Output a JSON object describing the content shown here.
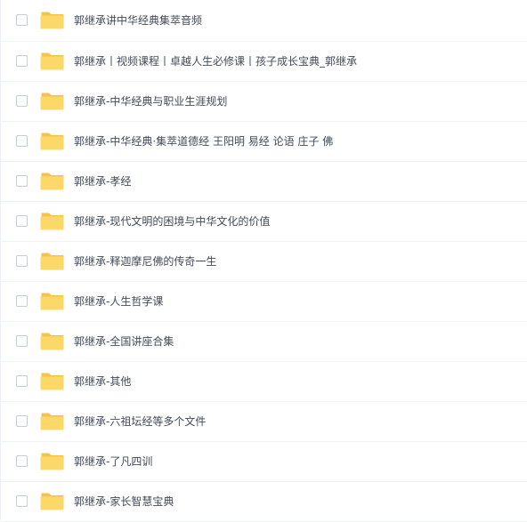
{
  "colors": {
    "folder_back": "#f5c34b",
    "folder_front": "#fbd868",
    "text": "#424a57",
    "divider": "#f1f2f4"
  },
  "files": [
    {
      "name": "郭继承讲中华经典集萃音频",
      "icon": "folder-icon"
    },
    {
      "name": "郭继承丨视频课程丨卓越人生必修课丨孩子成长宝典_郭继承",
      "icon": "folder-icon"
    },
    {
      "name": "郭继承-中华经典与职业生涯规划",
      "icon": "folder-icon"
    },
    {
      "name": "郭继承-中华经典·集萃道德经 王阳明 易经 论语 庄子 佛",
      "icon": "folder-icon"
    },
    {
      "name": "郭继承-孝经",
      "icon": "folder-icon"
    },
    {
      "name": "郭继承-现代文明的困境与中华文化的价值",
      "icon": "folder-icon"
    },
    {
      "name": "郭继承-释迦摩尼佛的传奇一生",
      "icon": "folder-icon"
    },
    {
      "name": "郭继承-人生哲学课",
      "icon": "folder-icon"
    },
    {
      "name": "郭继承-全国讲座合集",
      "icon": "folder-icon"
    },
    {
      "name": "郭继承-其他",
      "icon": "folder-icon"
    },
    {
      "name": "郭继承-六祖坛经等多个文件",
      "icon": "folder-icon"
    },
    {
      "name": "郭继承-了凡四训",
      "icon": "folder-icon"
    },
    {
      "name": "郭继承-家长智慧宝典",
      "icon": "folder-icon"
    }
  ]
}
